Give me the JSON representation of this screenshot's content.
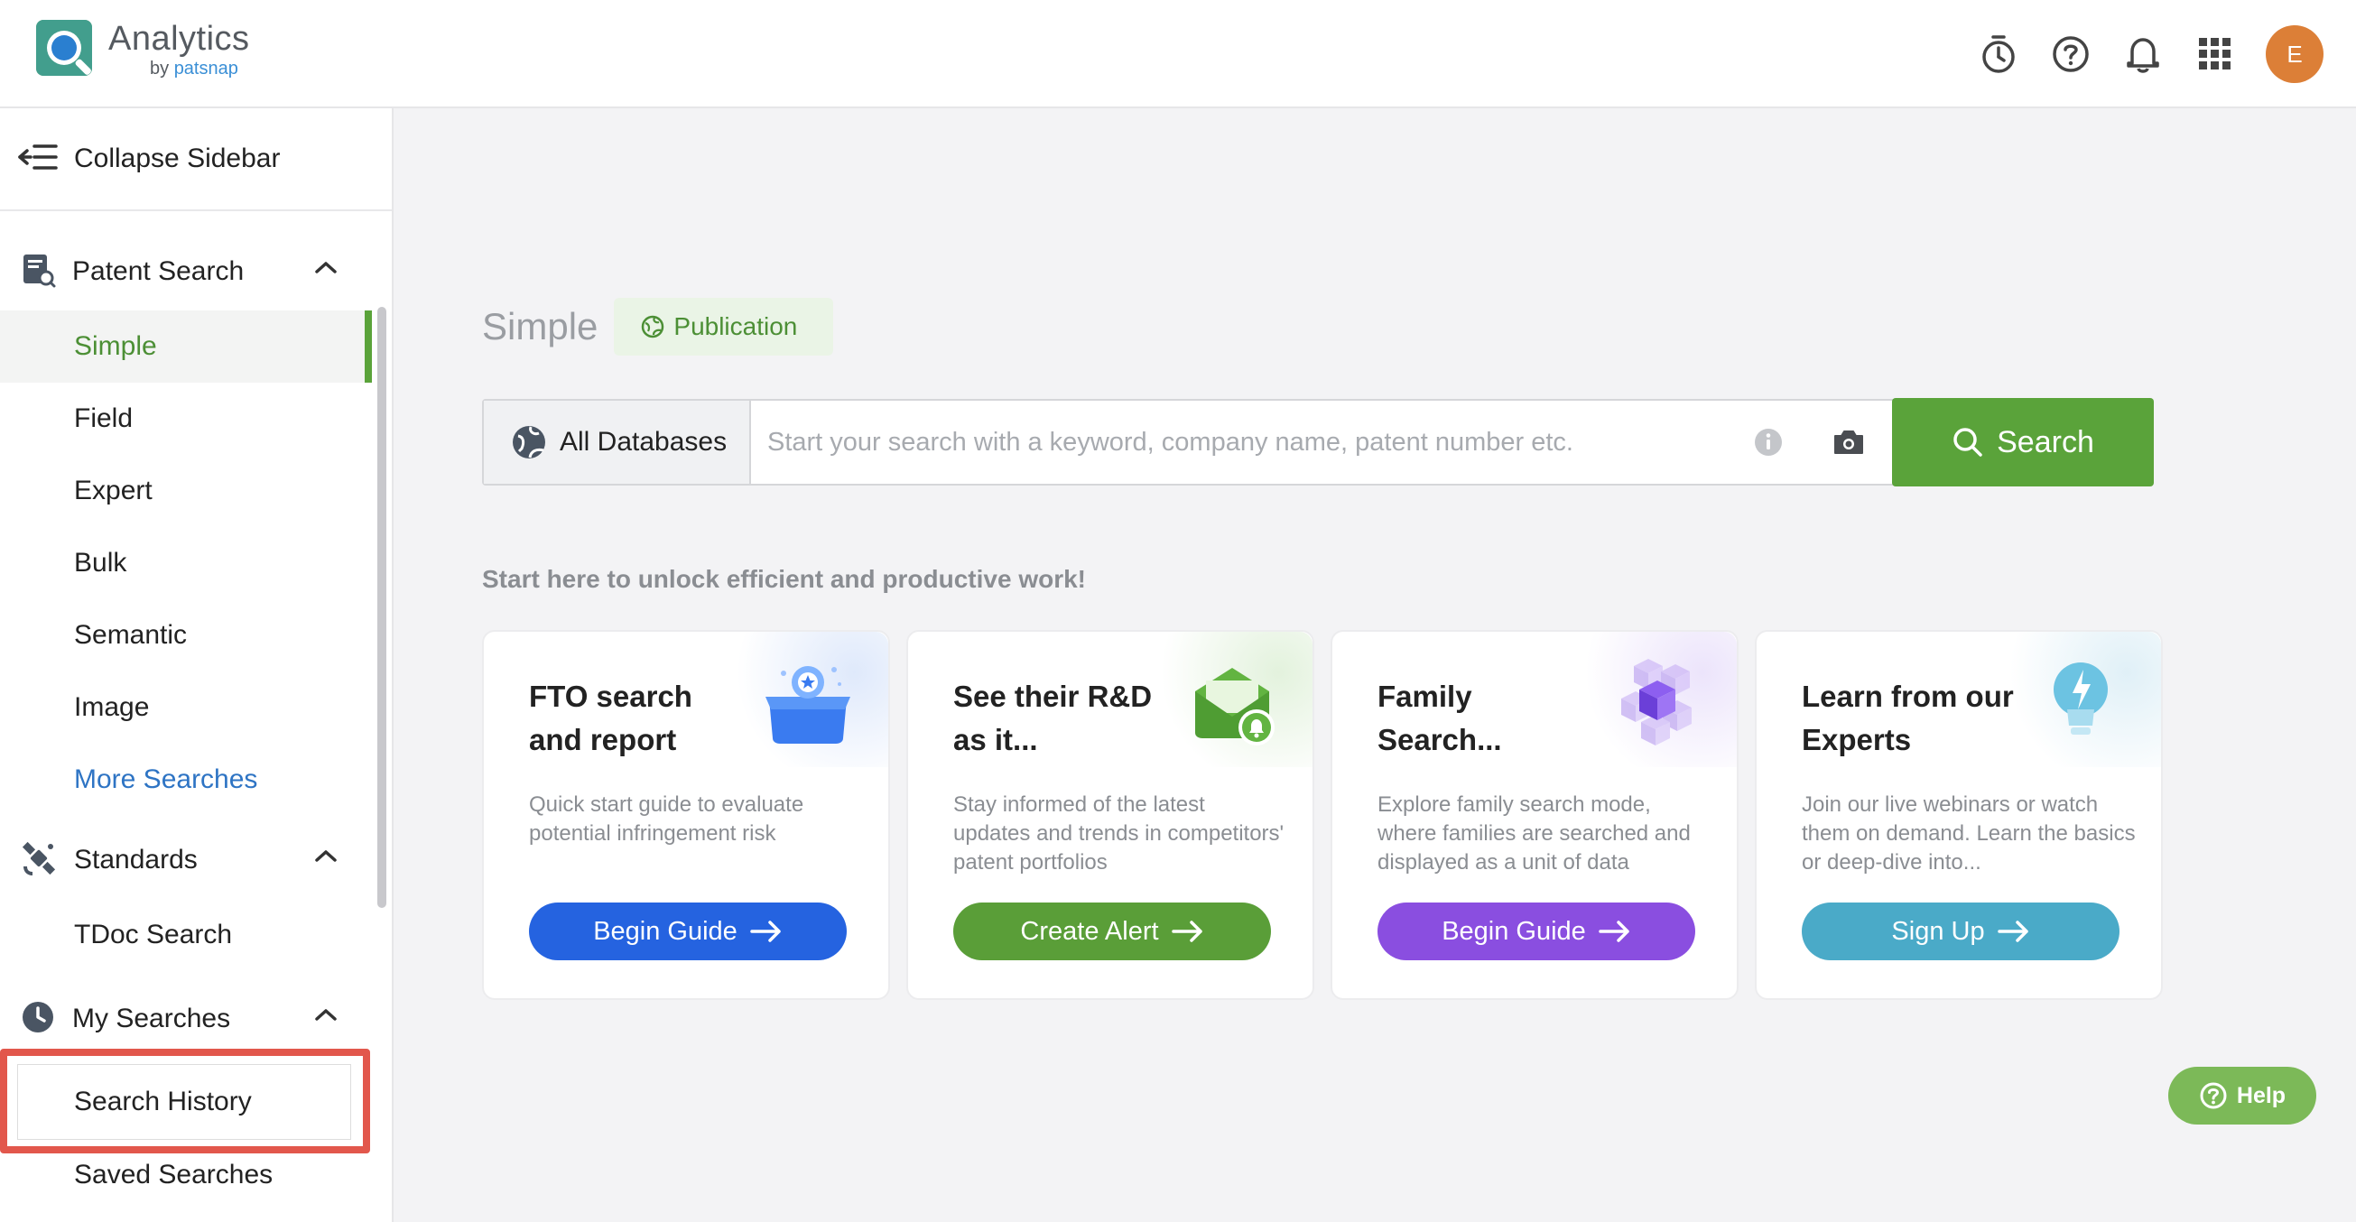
{
  "header": {
    "logo_title": "Analytics",
    "logo_sub_prefix": "by",
    "logo_sub_brand": "patsnap",
    "icons": [
      "timer-icon",
      "help-circle-icon",
      "bell-icon",
      "apps-grid-icon"
    ],
    "avatar_initial": "E",
    "avatar_color": "#dc7f37"
  },
  "sidebar": {
    "collapse_label": "Collapse Sidebar",
    "groups": [
      {
        "label": "Patent Search",
        "icon": "patent-search-icon",
        "items": [
          {
            "label": "Simple",
            "active": true
          },
          {
            "label": "Field"
          },
          {
            "label": "Expert"
          },
          {
            "label": "Bulk"
          },
          {
            "label": "Semantic"
          },
          {
            "label": "Image"
          },
          {
            "label": "More Searches",
            "link": true
          }
        ]
      },
      {
        "label": "Standards",
        "icon": "satellite-icon",
        "items": [
          {
            "label": "TDoc Search"
          }
        ]
      },
      {
        "label": "My Searches",
        "icon": "clock-icon",
        "items": [
          {
            "label": "Search History",
            "highlighted": true
          },
          {
            "label": "Saved Searches"
          }
        ]
      }
    ]
  },
  "main": {
    "title": "Simple",
    "badge": "Publication",
    "search": {
      "database_label": "All Databases",
      "placeholder": "Start your search with a keyword, company name, patent number etc.",
      "button_label": "Search"
    },
    "tagline": "Start here to unlock efficient and productive work!",
    "cards": [
      {
        "title": "FTO search and report",
        "description": "Quick start guide to evaluate potential infringement risk",
        "button": "Begin Guide",
        "button_color": "#2563e0",
        "icon": "box-star-icon"
      },
      {
        "title": "See their R&D as it...",
        "description": "Stay informed of the latest updates and trends in competitors' patent portfolios",
        "button": "Create Alert",
        "button_color": "#5a9e38",
        "icon": "mail-alert-icon"
      },
      {
        "title": "Family Search...",
        "description": "Explore family search mode, where families are searched and displayed as a unit of data",
        "button": "Begin Guide",
        "button_color": "#8a4ee0",
        "icon": "cubes-icon"
      },
      {
        "title": "Learn from our Experts",
        "description": "Join our live webinars or watch them on demand. Learn the basics or deep-dive into...",
        "button": "Sign Up",
        "button_color": "#4aaac8",
        "icon": "lightbulb-icon"
      }
    ]
  },
  "help_button": "Help",
  "colors": {
    "accent_green": "#5aa33a",
    "highlight_red": "#e2574c"
  }
}
